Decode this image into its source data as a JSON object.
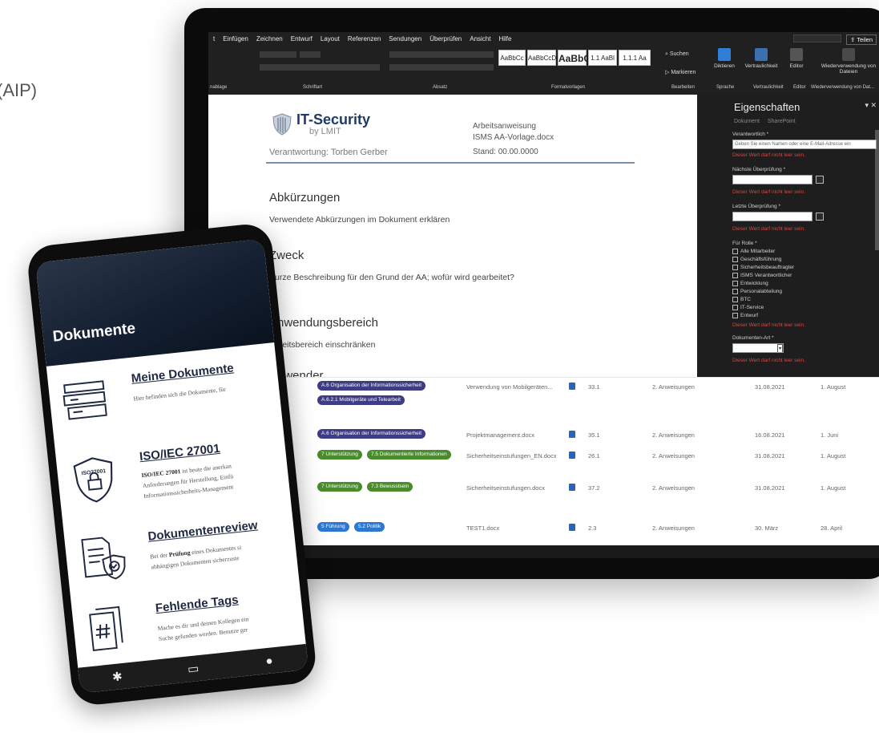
{
  "background_text": "(AIP)",
  "word": {
    "menu": [
      "t",
      "Einfügen",
      "Zeichnen",
      "Entwurf",
      "Layout",
      "Referenzen",
      "Sendungen",
      "Überprüfen",
      "Ansicht",
      "Hilfe"
    ],
    "share_label": "Teilen",
    "styles": [
      "AaBbCc",
      "AaBbCcD",
      "AaBbC",
      "1.1 AaBl",
      "1.1.1 Aa"
    ],
    "group_labels": [
      "nablage",
      "Schriftart",
      "Absatz",
      "Formatvorlagen",
      "Bearbeiten",
      "Sprache",
      "Vertraulichkeit",
      "Editor",
      "Wiederverwendung von Dat..."
    ],
    "right_tools": [
      "Diktieren",
      "Vertraulichkeit",
      "Editor",
      "Wiederverwendung von Dateien"
    ],
    "search_label": "Suchen",
    "edit_label": "Markieren"
  },
  "document": {
    "logo_title": "IT-Security",
    "logo_sub": "by LMIT",
    "responsibility": "Verantwortung: Torben Gerber",
    "aa_title": "Arbeitsanweisung",
    "aa_file": "ISMS AA-Vorlage.docx",
    "stand": "Stand: 00.00.0000",
    "sections": [
      {
        "heading": "Abkürzungen",
        "text": "Verwendete Abkürzungen im Dokument erklären"
      },
      {
        "heading": "Zweck",
        "text": "Kurze Beschreibung für den Grund der AA; wofür wird gearbeitet?"
      },
      {
        "heading": "Anwendungsbereich",
        "text": "Arbeitsbereich einschränken"
      },
      {
        "heading": "Anwender",
        "text": ""
      }
    ]
  },
  "properties": {
    "title": "Eigenschaften",
    "tabs": [
      "Dokument",
      "SharePoint"
    ],
    "field1_label": "Verantwortlich *",
    "field1_placeholder": "Geben Sie einen Namen oder eine E-Mail-Adresse ein",
    "error": "Dieser Wert darf nicht leer sein.",
    "field2_label": "Nächste Überprüfung *",
    "field3_label": "Letzte Überprüfung *",
    "field4_label": "Für Rolle *",
    "roles": [
      "Alle Mitarbeiter",
      "Geschäftsführung",
      "Sicherheitsbeauftragter",
      "ISMS Verantwortlicher",
      "Entwicklung",
      "Personalabteilung",
      "BTC",
      "IT-Service",
      "Entwurf"
    ],
    "field5_label": "Dokumenten-Art *"
  },
  "table": {
    "rows": [
      {
        "tags": [
          {
            "text": "A.6 Organisation der Informationssicherheit",
            "color": "purple"
          },
          {
            "text": "A.6.2.1 Mobilgeräte und Telearbeit",
            "color": "purple"
          }
        ],
        "file": "Verwendung von Mobilgeräten...",
        "version": "33.1",
        "category": "2. Anweisungen",
        "date": "31.08.2021",
        "due": "1. August"
      },
      {
        "tags": [
          {
            "text": "A.6 Organisation der Informationssicherheit",
            "color": "purple"
          }
        ],
        "file": "Projektmanagement.docx",
        "version": "35.1",
        "category": "2. Anweisungen",
        "date": "16.08.2021",
        "due": "1. Juni"
      },
      {
        "tags": [
          {
            "text": "7 Unterstützung",
            "color": "green"
          },
          {
            "text": "7.5 Dokumentierte Informationen",
            "color": "green"
          }
        ],
        "file": "Sicherheitseinstufungen_EN.docx",
        "version": "26.1",
        "category": "2. Anweisungen",
        "date": "31.08.2021",
        "due": "1. August"
      },
      {
        "tags": [
          {
            "text": "7 Unterstützung",
            "color": "green"
          },
          {
            "text": "7.3 Bewusstsein",
            "color": "green"
          }
        ],
        "file": "Sicherheitseinstufungen.docx",
        "version": "37.2",
        "category": "2. Anweisungen",
        "date": "31.08.2021",
        "due": "1. August"
      },
      {
        "tags": [
          {
            "text": "5 Führung",
            "color": "blue"
          },
          {
            "text": "5.2 Politik",
            "color": "blue"
          }
        ],
        "file": "TEST1.docx",
        "version": "2.3",
        "category": "2. Anweisungen",
        "date": "30. März",
        "due": "28. April"
      }
    ]
  },
  "phone": {
    "title": "Dokumente",
    "items": [
      {
        "title": "Meine Dokumente",
        "line1": "Hier befinden sich die Dokumente, für",
        "line2": "",
        "icon": "folder-stack-icon"
      },
      {
        "title": "ISO/IEC 27001",
        "line1_bold": "ISO/IEC 27001",
        "line1": " ist heute die anerkan",
        "line2": "Anforderungen für Herstellung, Einfü",
        "line3": "Informationssicherheits-Management",
        "icon": "iso-shield-icon",
        "badge": "ISO27001"
      },
      {
        "title": "Dokumentenreview",
        "line1_pre": "Bei der ",
        "line1_bold": "Prüfung",
        "line1": " eines Dokumentes si",
        "line2": "abhängigen Dokumenten sicherzuste",
        "icon": "document-review-icon"
      },
      {
        "title": "Fehlende Tags",
        "line1": "Mache es dir und deinen Kollegen ein",
        "line2": "Suche gefunden werden. Benutze ger",
        "icon": "hashtag-document-icon"
      }
    ],
    "nav": [
      "asterisk-icon",
      "document-icon",
      "user-icon"
    ]
  },
  "colors": {
    "brand": "#1e3a68",
    "purple_tag": "#3e3c82",
    "green_tag": "#4a8c2d",
    "blue_tag": "#2c77d1",
    "error": "#d04a4a"
  }
}
